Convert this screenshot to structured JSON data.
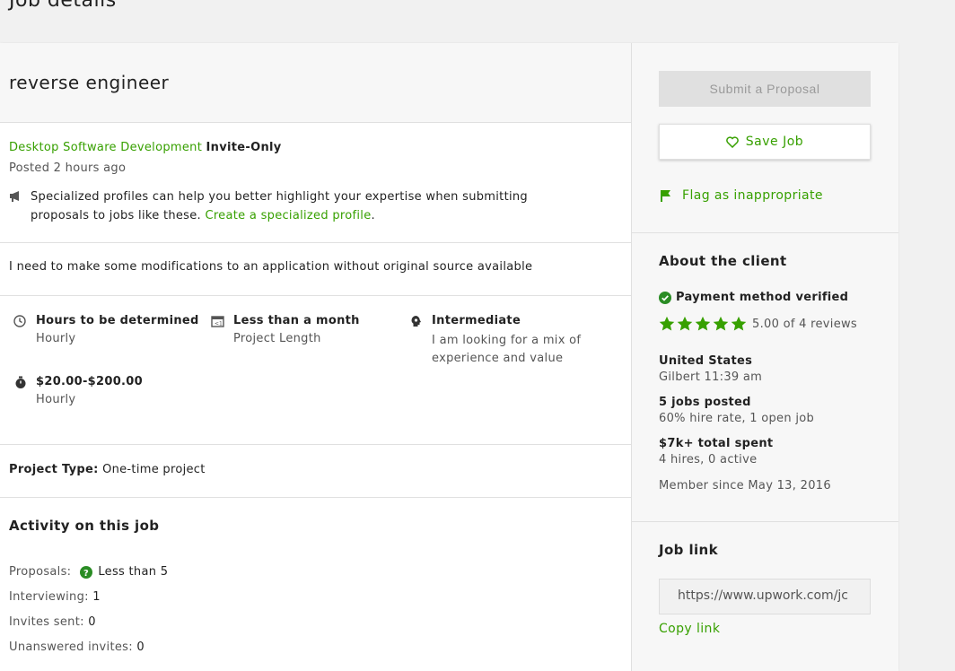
{
  "page": {
    "heading": "Job details"
  },
  "job": {
    "title": "reverse engineer",
    "category": "Desktop Software Development",
    "visibility": "Invite-Only",
    "posted": "Posted 2 hours ago",
    "promo_text": "Specialized profiles can help you better highlight your expertise when submitting proposals to jobs like these.",
    "promo_link": "Create a specialized profile",
    "promo_period": ".",
    "description": "I need to make some modifications to an application without original source available",
    "features": {
      "hours": {
        "title": "Hours to be determined",
        "sub": "Hourly"
      },
      "duration": {
        "title": "Less than a month",
        "sub": "Project Length"
      },
      "level": {
        "title": "Intermediate",
        "sub": "I am looking for a mix of experience and value"
      },
      "budget": {
        "title": "$20.00-$200.00",
        "sub": "Hourly"
      }
    },
    "project_type_label": "Project Type:",
    "project_type_value": "One-time project"
  },
  "activity": {
    "heading": "Activity on this job",
    "proposals_label": "Proposals:",
    "proposals_value": "Less than 5",
    "interviewing_label": "Interviewing:",
    "interviewing_value": "1",
    "invites_label": "Invites sent:",
    "invites_value": "0",
    "unanswered_label": "Unanswered invites:",
    "unanswered_value": "0"
  },
  "actions": {
    "submit": "Submit a Proposal",
    "save": "Save Job",
    "flag": "Flag as inappropriate"
  },
  "client": {
    "heading": "About the client",
    "payment": "Payment method verified",
    "rating": 5.0,
    "rating_text": "5.00 of 4 reviews",
    "country": "United States",
    "city_time": "Gilbert 11:39 am",
    "jobs_posted": "5 jobs posted",
    "hire_rate": "60% hire rate, 1 open job",
    "spent": "$7k+ total spent",
    "hires": "4 hires, 0 active",
    "member_since": "Member since May 13, 2016"
  },
  "job_link": {
    "heading": "Job link",
    "url": "https://www.upwork.com/jc",
    "copy": "Copy link"
  },
  "colors": {
    "accent": "#37a000",
    "verified": "#2a8c24"
  }
}
